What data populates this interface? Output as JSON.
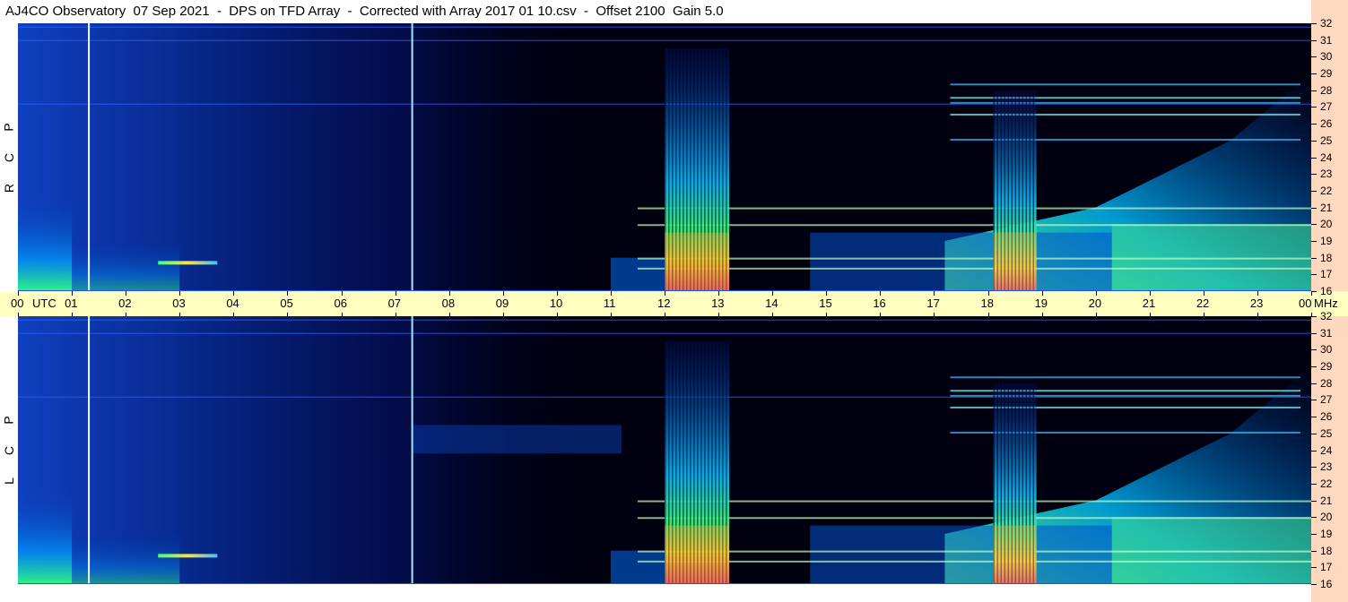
{
  "title": "AJ4CO Observatory  07 Sep 2021  -  DPS on TFD Array  -  Corrected with Array 2017 01 10.csv  -  Offset 2100  Gain 5.0",
  "panels": {
    "rcp_letters": [
      "R",
      "C",
      "P"
    ],
    "lcp_letters": [
      "L",
      "C",
      "P"
    ]
  },
  "colors": {
    "background": "#000000",
    "utc_axis_bg": "#ffffc0",
    "mhz_axis_bg": "#ffd9bf",
    "marker_white": "#f0ffff",
    "marker_cyan": "#a0e8ff"
  },
  "chart_data": {
    "type": "heatmap",
    "description_units": "x = UTC hour, y = frequency MHz",
    "x_axis": {
      "unit_label": "UTC",
      "range": [
        0,
        24
      ],
      "tick_labels": [
        "00",
        "01",
        "02",
        "03",
        "04",
        "05",
        "06",
        "07",
        "08",
        "09",
        "10",
        "11",
        "12",
        "13",
        "14",
        "15",
        "16",
        "17",
        "18",
        "19",
        "20",
        "21",
        "22",
        "23",
        "00"
      ]
    },
    "y_axis": {
      "unit_label": "MHz",
      "range": [
        16,
        32
      ],
      "tick_labels": [
        "32",
        "31",
        "30",
        "29",
        "28",
        "27",
        "26",
        "25",
        "24",
        "23",
        "22",
        "21",
        "20",
        "19",
        "18",
        "17",
        "16"
      ]
    },
    "vertical_markers_utc": [
      1.3,
      7.3
    ],
    "panels": [
      "RCP",
      "LCP"
    ],
    "bursts": [
      {
        "start": 12.0,
        "end": 13.2,
        "max_freq": 30.5
      },
      {
        "start": 18.1,
        "end": 18.9,
        "max_freq": 28.0
      }
    ],
    "bright_regions": [
      {
        "from": 0.0,
        "to": 1.0,
        "level": "high"
      },
      {
        "from": 20.0,
        "to": 24.0,
        "level": "high"
      }
    ]
  }
}
